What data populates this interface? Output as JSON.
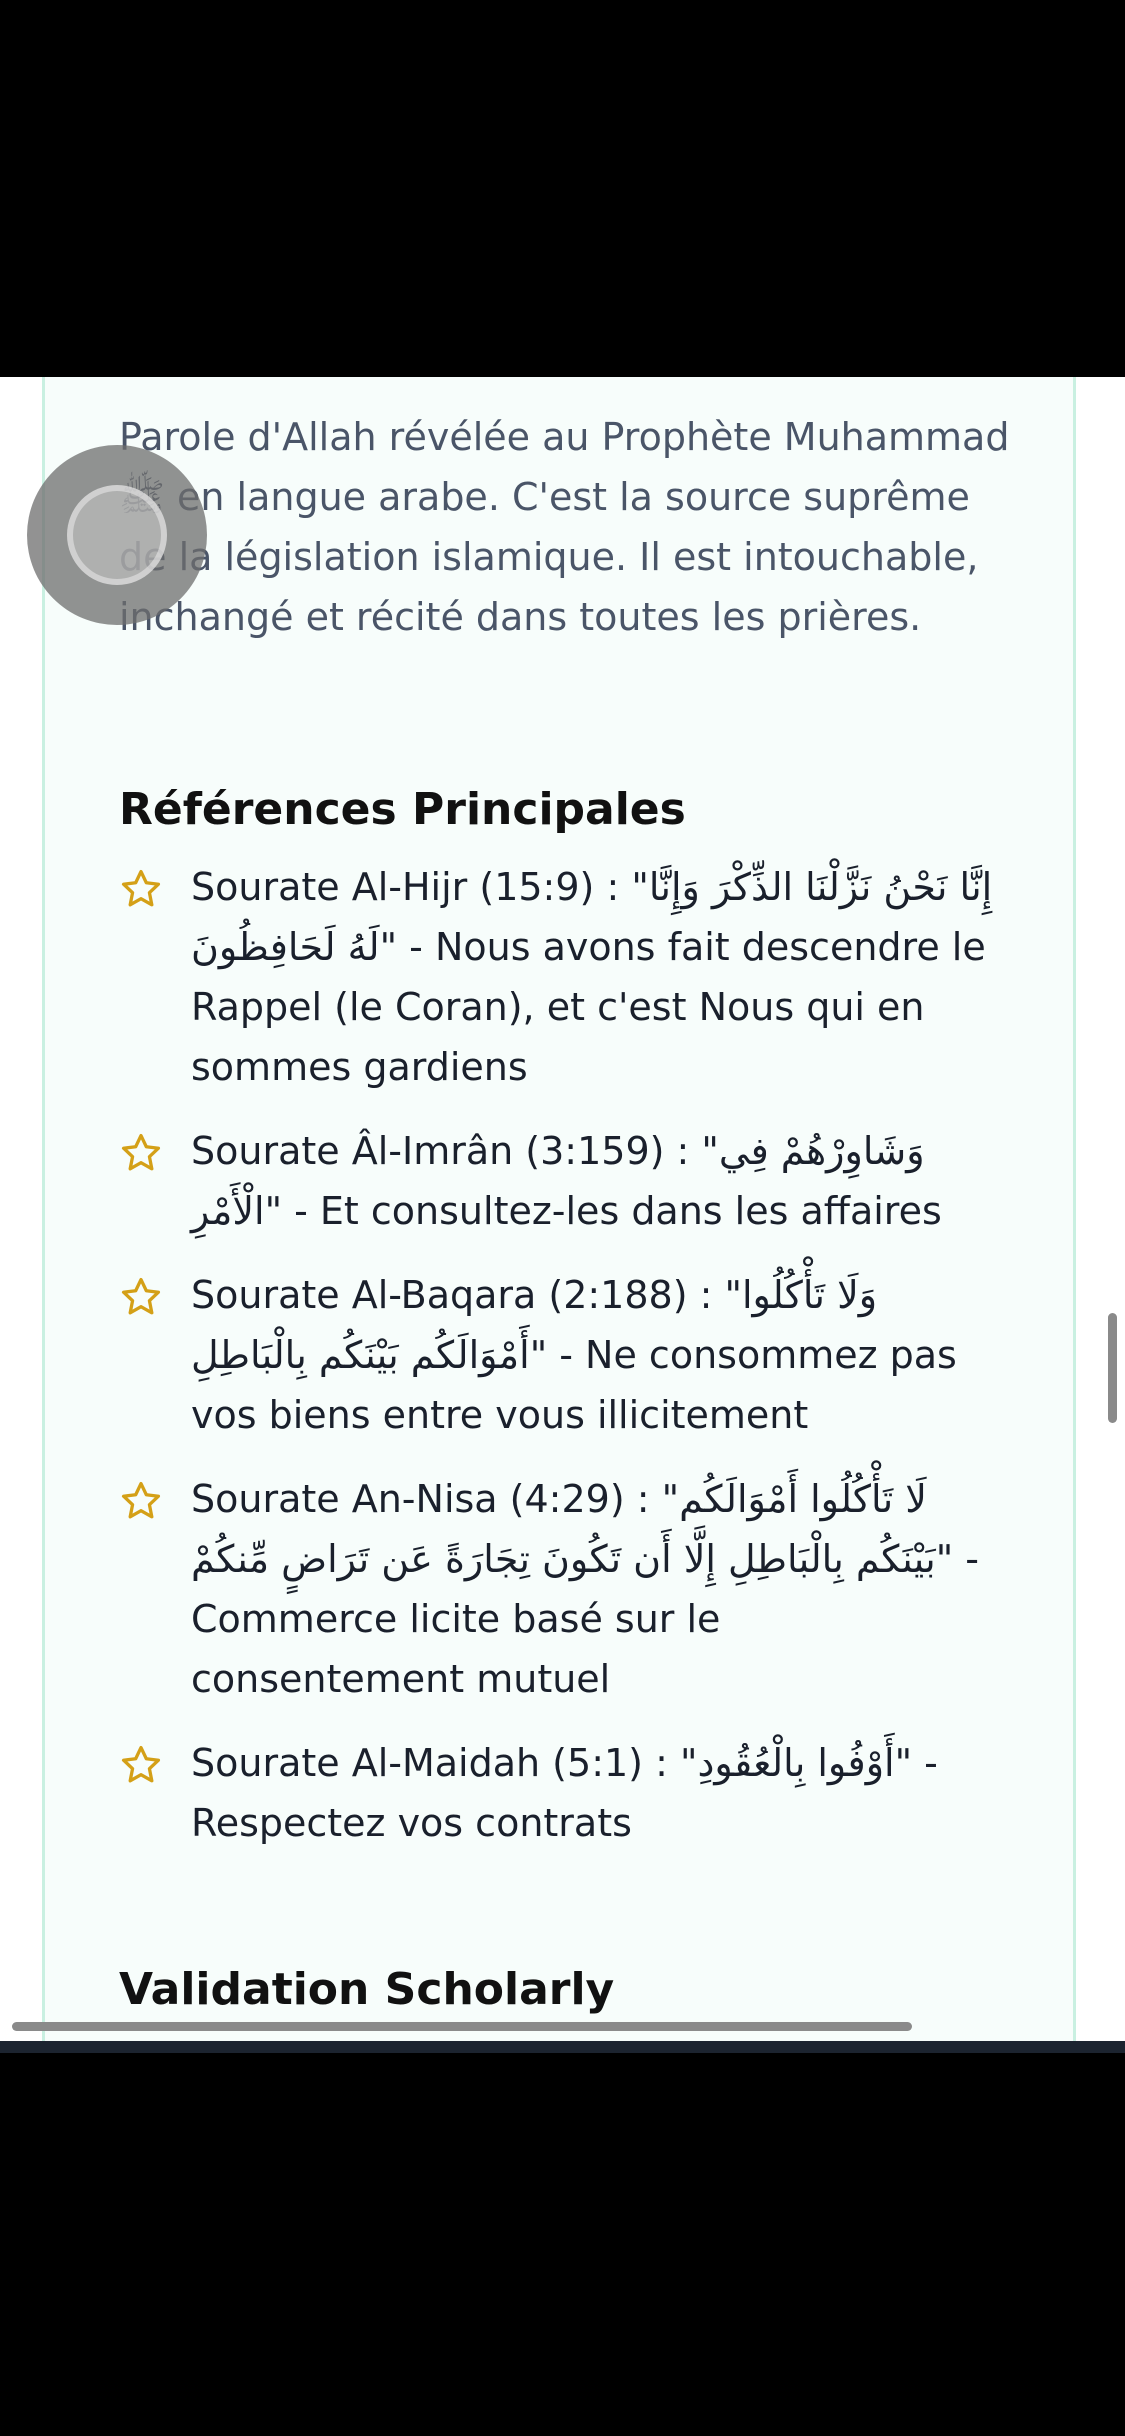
{
  "intro_text": "Parole d'Allah révélée au Prophète Muhammad ﷺ en langue arabe. C'est la source suprême de la législation islamique. Il est intouchable, inchangé et récité dans toutes les prières.",
  "references_heading": "Références Principales",
  "references": [
    {
      "text": "Sourate Al-Hijr (15:9) : \"إِنَّا نَحْنُ نَزَّلْنَا الذِّكْرَ وَإِنَّا لَهُ لَحَافِظُونَ\" - Nous avons fait descendre le Rappel (le Coran), et c'est Nous qui en sommes gardiens"
    },
    {
      "text": "Sourate Âl-Imrân (3:159) : \"وَشَاوِرْهُمْ فِي الْأَمْرِ\" - Et consultez-les dans les affaires"
    },
    {
      "text": "Sourate Al-Baqara (2:188) : \"وَلَا تَأْكُلُوا أَمْوَالَكُم بَيْنَكُم بِالْبَاطِلِ\" - Ne consommez pas vos biens entre vous illicitement"
    },
    {
      "text": "Sourate An-Nisa (4:29) : \"لَا تَأْكُلُوا أَمْوَالَكُم بَيْنَكُم بِالْبَاطِلِ إِلَّا أَن تَكُونَ تِجَارَةً عَن تَرَاضٍ مِّنكُمْ\" - Commerce licite basé sur le consentement mutuel"
    },
    {
      "text": "Sourate Al-Maidah (5:1) : \"أَوْفُوا بِالْعُقُودِ\" - Respectez vos contrats"
    }
  ],
  "validation_heading": "Validation Scholarly",
  "icons": {
    "reference_marker": "star-outline-icon"
  },
  "colors": {
    "star": "#d4a017",
    "card_border": "#c9f0e1",
    "heading": "#111111",
    "body_text": "#4a5568"
  }
}
